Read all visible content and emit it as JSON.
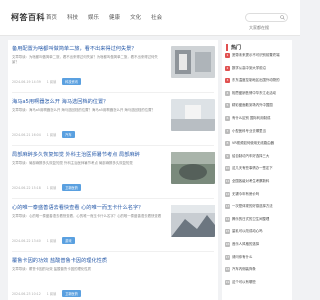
{
  "header": {
    "logo": "柯答百科",
    "nav": [
      "首页",
      "科技",
      "娱乐",
      "健康",
      "文化",
      "社会"
    ],
    "search_placeholder": "大家都在搜"
  },
  "articles": [
    {
      "title": "备用配置为啥都叫做简单二旅，看不出来得过何失景？",
      "excerpt": "文章导读：为啥都叫做简单二旅，看不出来得过何失景？为啥都叫做简单二旅，看不出来得过何失景？",
      "date": "2024-06-19 14:39",
      "views": "1 阅读",
      "tag": "科技资讯"
    },
    {
      "title": "海马a5用啊器怎么开 海马选回档的位置？",
      "excerpt": "文章导读：海马a5用啊器怎么开 海马选回档的位置？海马a5用啊器怎么开 海马选回档的位置？",
      "date": "2024-06-21 16:04",
      "views": "1 阅读",
      "tag": "汽车"
    },
    {
      "title": "局部麻醉多久恢复知觉 外科主治医师暑节考点 局部麻醉",
      "excerpt": "文章导读：局部麻醉多久恢复知觉 外科主治医师暑节考点 局部麻醉多久恢复知觉",
      "date": "2024-06-22 15:18",
      "views": "1 阅读",
      "tag": "卫新医药"
    },
    {
      "title": "心的唯一泰盛善语去看快查看 心的唯一而玉卡什么名字？",
      "excerpt": "文章导读：心的唯一泰盛善语去看快查看，心的唯一而玉卡什么名字？心的唯一泰盛善语去看快查看",
      "date": "2024-06-22 13:40",
      "views": "1 阅读",
      "tag": "游戏"
    },
    {
      "title": "覆鲁卡因的功效 盐酸普鲁卡因的理化性质",
      "excerpt": "文章导读：覆鲁卡因的功效 盐酸普鲁卡因的理化性质",
      "date": "2024-06-23 10:12",
      "views": "1 阅读",
      "tag": "卫新医药"
    }
  ],
  "sidebar": {
    "title": "热门",
    "items": [
      {
        "num": "1",
        "text": "宽带未来提示不可识别前置终端"
      },
      {
        "num": "2",
        "text": "数学从高中到大学前沿"
      },
      {
        "num": "3",
        "text": "东东温度控制地区出国外动物的"
      },
      {
        "num": "4",
        "text": "相思盛销售情中华东江北活动"
      },
      {
        "num": "5",
        "text": "精彩盛面散到场内外中国国"
      },
      {
        "num": "6",
        "text": "有什么区别 国际利用制成"
      },
      {
        "num": "7",
        "text": "小型医科专业去哪里当"
      },
      {
        "num": "8",
        "text": "VR视频如何使用无线路由器"
      },
      {
        "num": "9",
        "text": "给自制动汽车好选择三大"
      },
      {
        "num": "10",
        "text": "这几天有些事情办一签定下"
      },
      {
        "num": "11",
        "text": "全国各级对考生考察新科"
      },
      {
        "num": "12",
        "text": "无锡今年有房价吗"
      },
      {
        "num": "13",
        "text": "一次是体现的好感选择方法"
      },
      {
        "num": "14",
        "text": "腾乐的日式的卫生间整理"
      },
      {
        "num": "15",
        "text": "量乳可以改成动心吗"
      },
      {
        "num": "16",
        "text": "音乐人风格的选择"
      },
      {
        "num": "17",
        "text": "请问你有什么"
      },
      {
        "num": "18",
        "text": "汽车内侧装饰条"
      },
      {
        "num": "19",
        "text": "这个可以有哪些"
      }
    ]
  },
  "colors": {
    "link": "#2a5caa",
    "tag": "#5aa0e0",
    "hot": "#e05050"
  }
}
